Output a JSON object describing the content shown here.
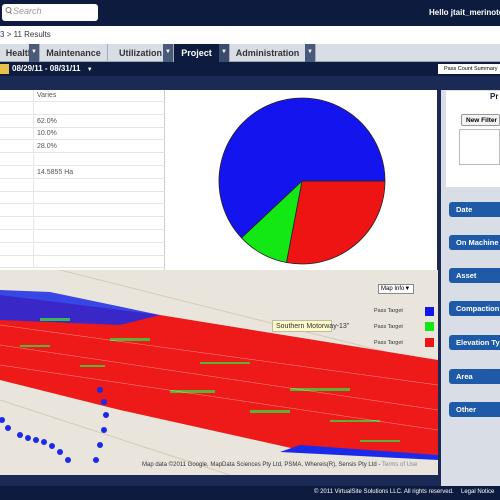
{
  "header": {
    "search_placeholder": "Search",
    "greeting": "Hello jtait_merinote"
  },
  "breadcrumb": {
    "prefix": "3",
    "sep": ">",
    "results": "11 Results"
  },
  "tabs": [
    {
      "label": "Health"
    },
    {
      "label": "Maintenance"
    },
    {
      "label": "Utilization"
    },
    {
      "label": "Project"
    },
    {
      "label": "Administration"
    }
  ],
  "datebar": {
    "range": "08/29/11 - 08/31/11",
    "pass_count_summary": "Pass Count Summary"
  },
  "table": {
    "values": [
      "Varies",
      "",
      "62.0%",
      "10.0%",
      "28.0%",
      "",
      "14.5855 Ha",
      "",
      "",
      "",
      "",
      "",
      "",
      ""
    ]
  },
  "chart_data": {
    "type": "pie",
    "categories": [
      "Blue",
      "Green",
      "Red"
    ],
    "values": [
      62.0,
      10.0,
      28.0
    ],
    "colors": [
      "#1414ee",
      "#14e814",
      "#ee1414"
    ]
  },
  "map": {
    "map_info": "Map Info",
    "callout": "Southern Motorway-13\"",
    "legend": [
      {
        "label": "Pass Target",
        "color": "#1414ee"
      },
      {
        "label": "Pass Target",
        "color": "#14e814"
      },
      {
        "label": "Pass Target",
        "color": "#ee1414"
      }
    ],
    "copyright": "Map data ©2011  Google, MapData Sciences Pty Ltd, PSMA, Whereis(R), Sensis Pty Ltd",
    "terms": "Terms of Use"
  },
  "right_panel": {
    "title": "Pr",
    "new_filter": "New Filter",
    "buttons": [
      "Date",
      "On Machine",
      "Asset",
      "Compaction",
      "Elevation Ty",
      "Area",
      "Other"
    ]
  },
  "footer": {
    "copyright": "© 2011 VirtualSite Solutions LLC. All rights reserved.",
    "legal": "Legal Notice"
  }
}
